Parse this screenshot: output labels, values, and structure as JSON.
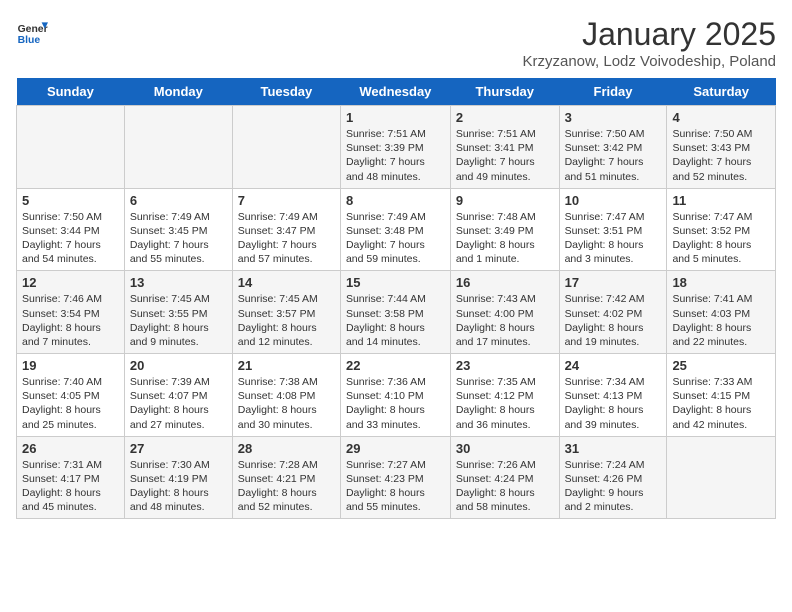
{
  "header": {
    "logo_general": "General",
    "logo_blue": "Blue",
    "title": "January 2025",
    "subtitle": "Krzyzanow, Lodz Voivodeship, Poland"
  },
  "days_of_week": [
    "Sunday",
    "Monday",
    "Tuesday",
    "Wednesday",
    "Thursday",
    "Friday",
    "Saturday"
  ],
  "weeks": [
    {
      "days": [
        {
          "num": "",
          "info": ""
        },
        {
          "num": "",
          "info": ""
        },
        {
          "num": "",
          "info": ""
        },
        {
          "num": "1",
          "info": "Sunrise: 7:51 AM\nSunset: 3:39 PM\nDaylight: 7 hours\nand 48 minutes."
        },
        {
          "num": "2",
          "info": "Sunrise: 7:51 AM\nSunset: 3:41 PM\nDaylight: 7 hours\nand 49 minutes."
        },
        {
          "num": "3",
          "info": "Sunrise: 7:50 AM\nSunset: 3:42 PM\nDaylight: 7 hours\nand 51 minutes."
        },
        {
          "num": "4",
          "info": "Sunrise: 7:50 AM\nSunset: 3:43 PM\nDaylight: 7 hours\nand 52 minutes."
        }
      ]
    },
    {
      "days": [
        {
          "num": "5",
          "info": "Sunrise: 7:50 AM\nSunset: 3:44 PM\nDaylight: 7 hours\nand 54 minutes."
        },
        {
          "num": "6",
          "info": "Sunrise: 7:49 AM\nSunset: 3:45 PM\nDaylight: 7 hours\nand 55 minutes."
        },
        {
          "num": "7",
          "info": "Sunrise: 7:49 AM\nSunset: 3:47 PM\nDaylight: 7 hours\nand 57 minutes."
        },
        {
          "num": "8",
          "info": "Sunrise: 7:49 AM\nSunset: 3:48 PM\nDaylight: 7 hours\nand 59 minutes."
        },
        {
          "num": "9",
          "info": "Sunrise: 7:48 AM\nSunset: 3:49 PM\nDaylight: 8 hours\nand 1 minute."
        },
        {
          "num": "10",
          "info": "Sunrise: 7:47 AM\nSunset: 3:51 PM\nDaylight: 8 hours\nand 3 minutes."
        },
        {
          "num": "11",
          "info": "Sunrise: 7:47 AM\nSunset: 3:52 PM\nDaylight: 8 hours\nand 5 minutes."
        }
      ]
    },
    {
      "days": [
        {
          "num": "12",
          "info": "Sunrise: 7:46 AM\nSunset: 3:54 PM\nDaylight: 8 hours\nand 7 minutes."
        },
        {
          "num": "13",
          "info": "Sunrise: 7:45 AM\nSunset: 3:55 PM\nDaylight: 8 hours\nand 9 minutes."
        },
        {
          "num": "14",
          "info": "Sunrise: 7:45 AM\nSunset: 3:57 PM\nDaylight: 8 hours\nand 12 minutes."
        },
        {
          "num": "15",
          "info": "Sunrise: 7:44 AM\nSunset: 3:58 PM\nDaylight: 8 hours\nand 14 minutes."
        },
        {
          "num": "16",
          "info": "Sunrise: 7:43 AM\nSunset: 4:00 PM\nDaylight: 8 hours\nand 17 minutes."
        },
        {
          "num": "17",
          "info": "Sunrise: 7:42 AM\nSunset: 4:02 PM\nDaylight: 8 hours\nand 19 minutes."
        },
        {
          "num": "18",
          "info": "Sunrise: 7:41 AM\nSunset: 4:03 PM\nDaylight: 8 hours\nand 22 minutes."
        }
      ]
    },
    {
      "days": [
        {
          "num": "19",
          "info": "Sunrise: 7:40 AM\nSunset: 4:05 PM\nDaylight: 8 hours\nand 25 minutes."
        },
        {
          "num": "20",
          "info": "Sunrise: 7:39 AM\nSunset: 4:07 PM\nDaylight: 8 hours\nand 27 minutes."
        },
        {
          "num": "21",
          "info": "Sunrise: 7:38 AM\nSunset: 4:08 PM\nDaylight: 8 hours\nand 30 minutes."
        },
        {
          "num": "22",
          "info": "Sunrise: 7:36 AM\nSunset: 4:10 PM\nDaylight: 8 hours\nand 33 minutes."
        },
        {
          "num": "23",
          "info": "Sunrise: 7:35 AM\nSunset: 4:12 PM\nDaylight: 8 hours\nand 36 minutes."
        },
        {
          "num": "24",
          "info": "Sunrise: 7:34 AM\nSunset: 4:13 PM\nDaylight: 8 hours\nand 39 minutes."
        },
        {
          "num": "25",
          "info": "Sunrise: 7:33 AM\nSunset: 4:15 PM\nDaylight: 8 hours\nand 42 minutes."
        }
      ]
    },
    {
      "days": [
        {
          "num": "26",
          "info": "Sunrise: 7:31 AM\nSunset: 4:17 PM\nDaylight: 8 hours\nand 45 minutes."
        },
        {
          "num": "27",
          "info": "Sunrise: 7:30 AM\nSunset: 4:19 PM\nDaylight: 8 hours\nand 48 minutes."
        },
        {
          "num": "28",
          "info": "Sunrise: 7:28 AM\nSunset: 4:21 PM\nDaylight: 8 hours\nand 52 minutes."
        },
        {
          "num": "29",
          "info": "Sunrise: 7:27 AM\nSunset: 4:23 PM\nDaylight: 8 hours\nand 55 minutes."
        },
        {
          "num": "30",
          "info": "Sunrise: 7:26 AM\nSunset: 4:24 PM\nDaylight: 8 hours\nand 58 minutes."
        },
        {
          "num": "31",
          "info": "Sunrise: 7:24 AM\nSunset: 4:26 PM\nDaylight: 9 hours\nand 2 minutes."
        },
        {
          "num": "",
          "info": ""
        }
      ]
    }
  ]
}
